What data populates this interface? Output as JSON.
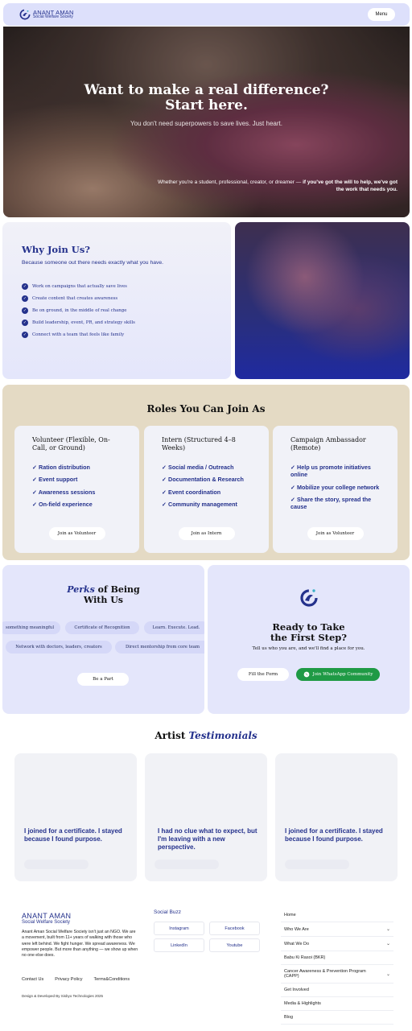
{
  "header": {
    "logo_name": "ANANT AMAN",
    "logo_subtitle": "Social Welfare Society",
    "menu_label": "Menu"
  },
  "hero": {
    "title_line1": "Want to make a real difference?",
    "title_line2": "Start here.",
    "subtitle": "You don't need superpowers to save lives. Just heart.",
    "note_regular": "Whether you're a student, professional, creator, or dreamer — ",
    "note_bold": "if you've got the will to help, we've got the work that needs you."
  },
  "why": {
    "title": "Why Join Us?",
    "lead": "Because someone out there needs exactly what you have.",
    "items": [
      "Work on campaigns that actually save lives",
      "Create content that creates awareness",
      "Be on ground, in the middle of real change",
      "Build leadership, event, PR, and strategy skills",
      "Connect with a team that feels like family"
    ]
  },
  "roles": {
    "title": "Roles You Can Join As",
    "cards": [
      {
        "title": "Volunteer (Flexible, On-Call, or Ground)",
        "items": [
          "✓ Ration distribution",
          "✓ Event support",
          "✓ Awareness sessions",
          "✓ On-field experience"
        ],
        "button": "Join as Volunteer"
      },
      {
        "title": "Intern (Structured 4–8 Weeks)",
        "items": [
          "✓ Social media / Outreach",
          "✓ Documentation & Research",
          "✓ Event coordination",
          "✓ Community management"
        ],
        "button": "Join as Intern"
      },
      {
        "title": "Campaign Ambassador (Remote)",
        "items": [
          "✓ Help us promote initiatives online",
          "✓ Mobilize your college network",
          "✓ Share the story, spread the cause"
        ],
        "button": "Join as Volunteer"
      }
    ]
  },
  "perks": {
    "title_italic": "Perks",
    "title_rest1": " of Being",
    "title_rest2": "With Us",
    "pills": [
      "something meaningful",
      "Certificate of Recognition",
      "Learn. Execute. Lead.",
      "Network with doctors, leaders, creators",
      "Direct mentorship from core team"
    ],
    "button": "Be a Part"
  },
  "ready": {
    "title_line1": "Ready to Take",
    "title_line2": "the First Step?",
    "subtitle": "Tell us who you are, and we'll find a place for you.",
    "fill_button": "Fill the Form",
    "whatsapp_button": "Join WhatsApp Community",
    "whatsapp_color": "#1f9a45"
  },
  "testimonials": {
    "title_regular": "Artist ",
    "title_italic": "Testimonials",
    "cards": [
      "I joined for a certificate. I stayed because I found purpose.",
      "I had no clue what to expect, but I'm leaving with a new perspective.",
      "I joined for a certificate. I stayed because I found purpose."
    ]
  },
  "footer": {
    "brand_name": "ANANT AMAN",
    "brand_sub": "Social Welfare Society",
    "about": "Anant Aman Social Welfare Society isn't just an NGO. We are a movement, built from 11+ years of walking with those who were left behind. We fight hunger. We spread awareness. We empower people. But more than anything — we show up when no one else does.",
    "links": [
      "Contact Us",
      "Privacy Policy",
      "Terms&Conditions"
    ],
    "credit": "Design & Developed By Sisbyo Technologies 2025",
    "social_title": "Social Buzz",
    "social": [
      "Instagram",
      "Facebook",
      "LinkedIn",
      "Youtube"
    ],
    "nav": [
      {
        "label": "Home",
        "chevron": false
      },
      {
        "label": "Who We Are",
        "chevron": true
      },
      {
        "label": "What We Do",
        "chevron": true
      },
      {
        "label": "Babu Ki Rasoi (BKR)",
        "chevron": false
      },
      {
        "label": "Cancer Awareness & Prevention Program (CAPP)",
        "chevron": true
      },
      {
        "label": "Get Involved",
        "chevron": false
      },
      {
        "label": "Media & Highlights",
        "chevron": false
      },
      {
        "label": "Blog",
        "chevron": false
      }
    ]
  },
  "colors": {
    "brand_navy": "#24318c",
    "header_bg": "#dde0fb",
    "roles_bg": "#e4dac4",
    "panel_bg": "#e4e6fb"
  }
}
